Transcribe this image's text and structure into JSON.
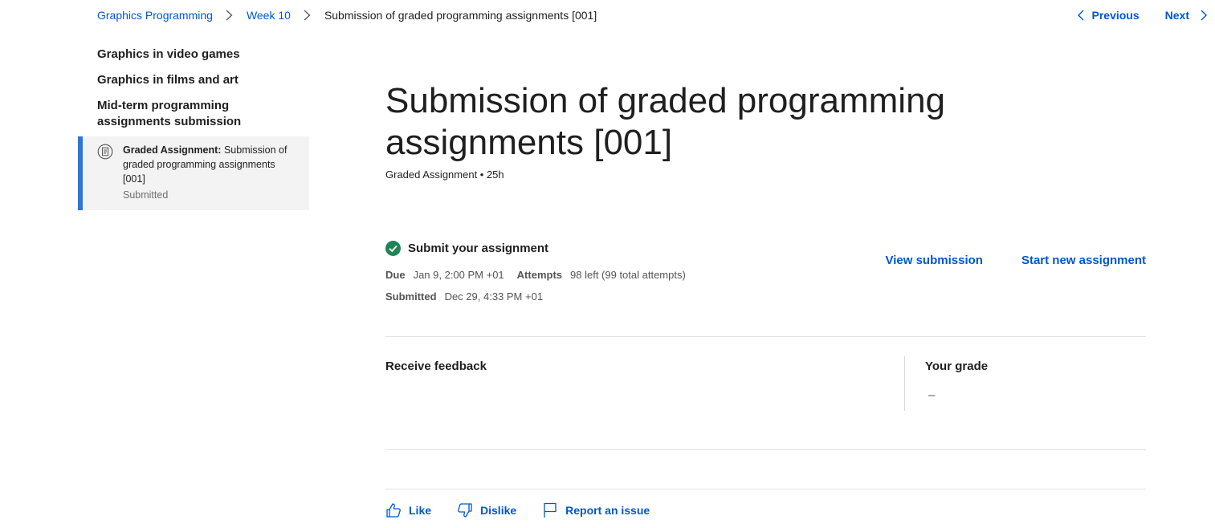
{
  "breadcrumb": {
    "items": [
      "Graphics Programming",
      "Week 10"
    ],
    "current": "Submission of graded programming assignments [001]"
  },
  "pager": {
    "previous": "Previous",
    "next": "Next"
  },
  "sidebar": {
    "headings": [
      "Graphics in video games",
      "Graphics in films and art",
      "Mid-term programming assignments submission"
    ],
    "active_item": {
      "type_label": "Graded Assignment:",
      "title": " Submission of graded programming assignments [001]",
      "status": "Submitted"
    }
  },
  "main": {
    "title": "Submission of graded programming assignments [001]",
    "meta": "Graded Assignment • 25h"
  },
  "submission": {
    "heading": "Submit your assignment",
    "due_label": "Due",
    "due_value": "Jan 9, 2:00 PM +01",
    "attempts_label": "Attempts",
    "attempts_value": "98 left (99 total attempts)",
    "submitted_label": "Submitted",
    "submitted_value": "Dec 29, 4:33 PM +01",
    "view_submission": "View submission",
    "start_new": "Start new assignment"
  },
  "feedback": {
    "label": "Receive feedback",
    "grade_label": "Your grade",
    "grade_value": "–"
  },
  "footer": {
    "like": "Like",
    "dislike": "Dislike",
    "report": "Report an issue"
  },
  "colors": {
    "link": "#0056d2",
    "accent_bar": "#2f74d6",
    "success": "#1f8354"
  }
}
